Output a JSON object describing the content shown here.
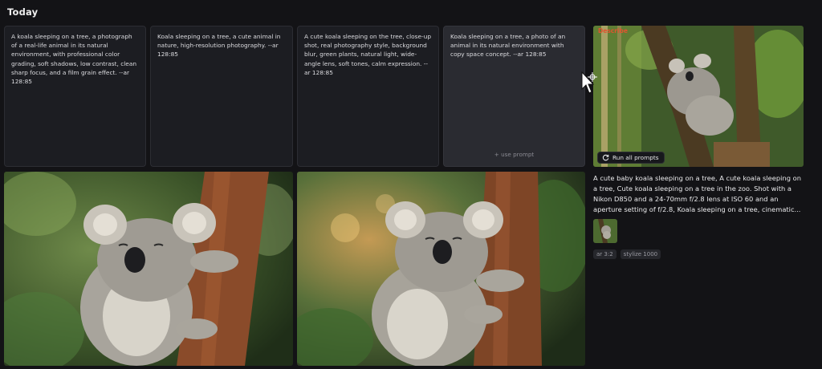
{
  "section": {
    "title": "Today"
  },
  "prompts": [
    {
      "text": "A koala sleeping on a tree, a photograph of a real-life animal in its natural environment, with professional color grading, soft shadows, low contrast, clean sharp focus, and a film grain effect. --ar 128:85"
    },
    {
      "text": "Koala sleeping on a tree, a cute animal in nature, high-resolution photography. --ar 128:85"
    },
    {
      "text": "A cute koala sleeping on the tree, close-up shot, real photography style, background blur, green plants, natural light, wide-angle lens, soft tones, calm expression. --ar 128:85"
    },
    {
      "text": "Koala sleeping on a tree, a photo of an animal in its natural environment with copy space concept. --ar 128:85",
      "action": "+ use prompt"
    }
  ],
  "describe": {
    "badge": "Describe",
    "run_label": "Run all prompts",
    "description": "A cute baby koala sleeping on a tree, A cute koala sleeping on a tree, Cute koala sleeping on a tree in the zoo. Shot with a Nikon D850 and a 24-70mm f/2.8 lens at ISO 60 and an aperture setting of f/2.8, Koala sleeping on a tree, cinematic...",
    "tags": [
      "ar 3:2",
      "stylize 1000"
    ]
  },
  "icons": {
    "run": "refresh-icon",
    "cursor": "mouse-pointer-icon",
    "crosshair": "crosshair-icon"
  },
  "colors": {
    "background": "#131316",
    "card": "#1c1d22",
    "card_hover": "#2a2b31",
    "accent": "#e0542f"
  }
}
